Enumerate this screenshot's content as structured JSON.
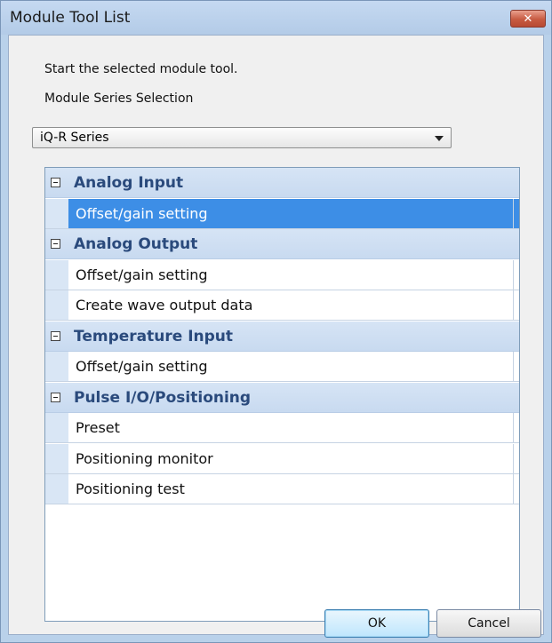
{
  "window": {
    "title": "Module Tool List"
  },
  "header": {
    "instruction": "Start the selected module tool.",
    "series_label": "Module Series Selection"
  },
  "series_select": {
    "value": "iQ-R Series"
  },
  "categories": [
    {
      "label": "Analog Input",
      "items": [
        "Offset/gain setting"
      ]
    },
    {
      "label": "Analog Output",
      "items": [
        "Offset/gain setting",
        "Create wave output data"
      ]
    },
    {
      "label": "Temperature Input",
      "items": [
        "Offset/gain setting"
      ]
    },
    {
      "label": "Pulse I/O/Positioning",
      "items": [
        "Preset",
        "Positioning monitor",
        "Positioning test"
      ]
    }
  ],
  "selected": {
    "category": 0,
    "item": 0
  },
  "buttons": {
    "ok": "OK",
    "cancel": "Cancel"
  },
  "icons": {
    "close": "close-icon",
    "dropdown": "chevron-down-icon",
    "collapse": "collapse-minus-icon"
  },
  "colors": {
    "selection": "#3d8ee6",
    "category_text": "#2a4a7c"
  }
}
